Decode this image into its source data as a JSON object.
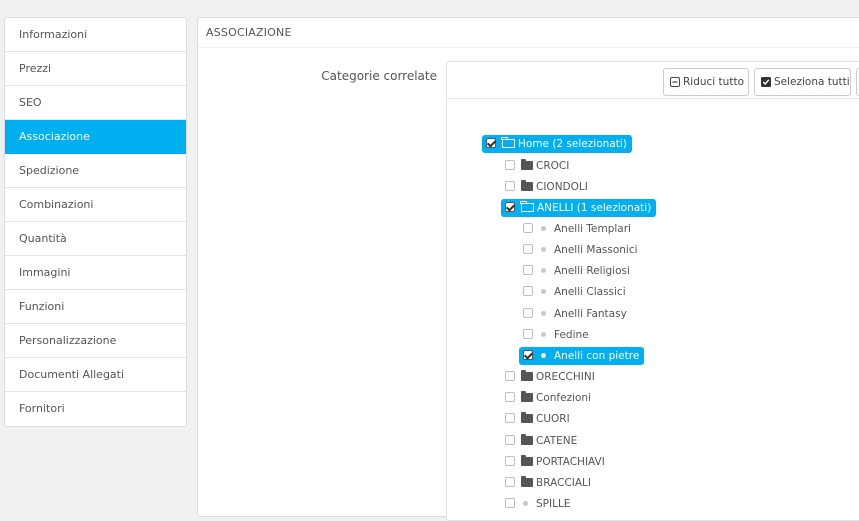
{
  "sidebar": {
    "items": [
      {
        "label": "Informazioni"
      },
      {
        "label": "Prezzi"
      },
      {
        "label": "SEO"
      },
      {
        "label": "Associazione"
      },
      {
        "label": "Spedizione"
      },
      {
        "label": "Combinazioni"
      },
      {
        "label": "Quantità"
      },
      {
        "label": "Immagini"
      },
      {
        "label": "Funzioni"
      },
      {
        "label": "Personalizzazione"
      },
      {
        "label": "Documenti Allegati"
      },
      {
        "label": "Fornitori"
      }
    ],
    "active_index": 3
  },
  "panel": {
    "title": "ASSOCIAZIONE",
    "field_label": "Categorie correlate"
  },
  "toolbar": {
    "collapse_label": "Riduci tutto",
    "select_all_label": "Seleziona tutti"
  },
  "tree": {
    "home": {
      "label": "Home (2 selezionati)",
      "checked": true
    },
    "nodes": [
      {
        "label": "CROCI",
        "type": "folder",
        "checked": false
      },
      {
        "label": "CIONDOLI",
        "type": "folder",
        "checked": false
      },
      {
        "label": "ANELLI (1 selezionati)",
        "type": "folder-open",
        "checked": true
      },
      {
        "label": "Anelli Templari",
        "type": "leaf",
        "checked": false
      },
      {
        "label": "Anelli Massonici",
        "type": "leaf",
        "checked": false
      },
      {
        "label": "Anelli Religiosi",
        "type": "leaf",
        "checked": false
      },
      {
        "label": "Anelli Classici",
        "type": "leaf",
        "checked": false
      },
      {
        "label": "Anelli Fantasy",
        "type": "leaf",
        "checked": false
      },
      {
        "label": "Fedine",
        "type": "leaf",
        "checked": false
      },
      {
        "label": "Anelli con pietre",
        "type": "leaf",
        "checked": true
      },
      {
        "label": "ORECCHINI",
        "type": "folder",
        "checked": false
      },
      {
        "label": "Confezioni",
        "type": "folder",
        "checked": false
      },
      {
        "label": "CUORI",
        "type": "folder",
        "checked": false
      },
      {
        "label": "CATENE",
        "type": "folder",
        "checked": false
      },
      {
        "label": "PORTACHIAVI",
        "type": "folder",
        "checked": false
      },
      {
        "label": "BRACCIALI",
        "type": "folder",
        "checked": false
      },
      {
        "label": "SPILLE",
        "type": "leaf",
        "checked": false
      }
    ]
  },
  "colors": {
    "accent": "#00aff0",
    "background": "#eff1f2"
  }
}
